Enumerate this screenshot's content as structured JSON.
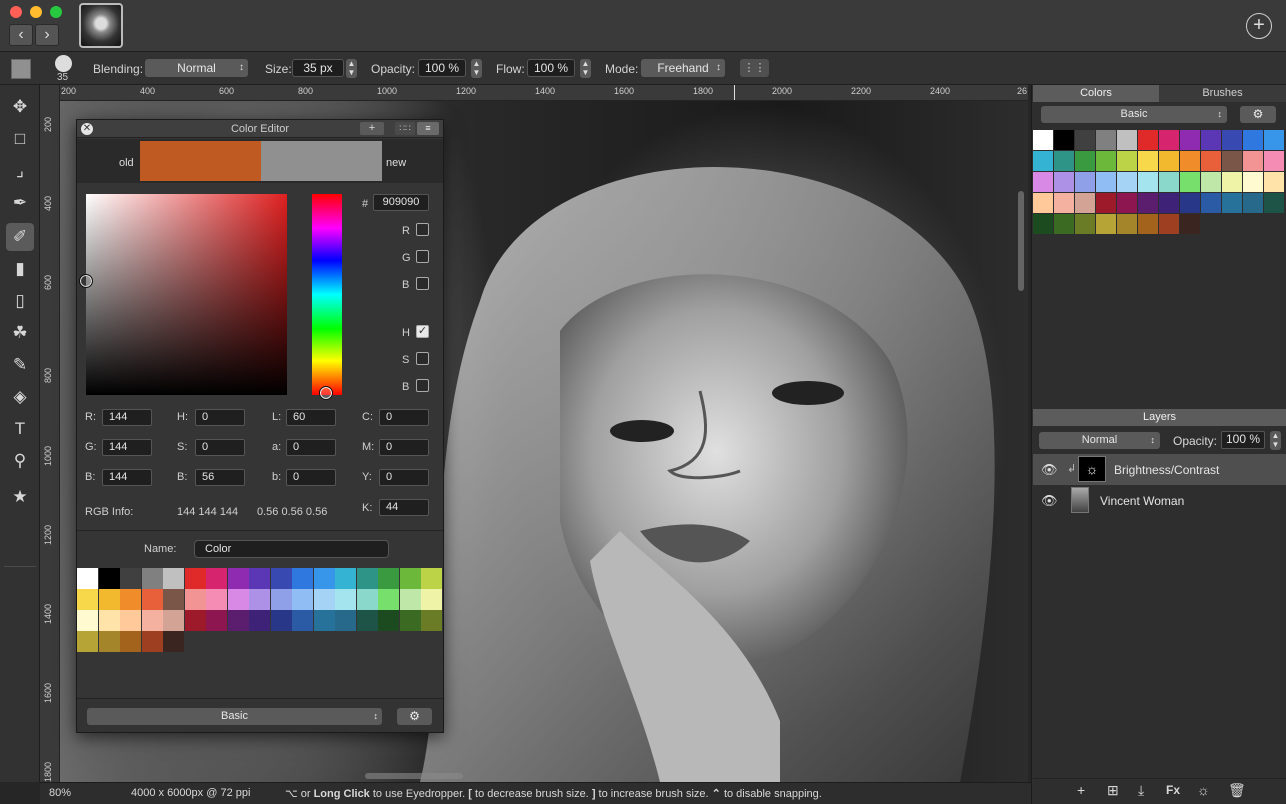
{
  "toolbar": {
    "brush_size": "35",
    "blending_label": "Blending:",
    "blending_value": "Normal",
    "size_label": "Size:",
    "size_value": "35 px",
    "opacity_label": "Opacity:",
    "opacity_value": "100 %",
    "flow_label": "Flow:",
    "flow_value": "100 %",
    "mode_label": "Mode:",
    "mode_value": "Freehand"
  },
  "rulers": {
    "top": [
      "200",
      "400",
      "600",
      "800",
      "1000",
      "1200",
      "1400",
      "1600",
      "1800",
      "2000",
      "2200",
      "2400",
      "26"
    ],
    "left": [
      "200",
      "400",
      "600",
      "800",
      "1000",
      "1200",
      "1400",
      "1600",
      "1800"
    ]
  },
  "color_editor": {
    "title": "Color Editor",
    "old_label": "old",
    "new_label": "new",
    "old_color": "#bf5a22",
    "new_color": "#909090",
    "hex_prefix": "#",
    "hex_value": "909090",
    "channels": {
      "r_check": "R",
      "g_check": "G",
      "b_check": "B",
      "h_check": "H",
      "s_check": "S",
      "bb_check": "B"
    },
    "fields": {
      "r_label": "R:",
      "r": "144",
      "g_label": "G:",
      "g": "144",
      "b_label": "B:",
      "b": "144",
      "h_label": "H:",
      "h": "0",
      "s_label": "S:",
      "s": "0",
      "bv_label": "B:",
      "bv": "56",
      "l_label": "L:",
      "l": "60",
      "a_label": "a:",
      "a": "0",
      "lab_b_label": "b:",
      "lab_b": "0",
      "c_label": "C:",
      "c": "0",
      "m_label": "M:",
      "m": "0",
      "y_label": "Y:",
      "y": "0",
      "k_label": "K:",
      "k": "44"
    },
    "rgb_info_label": "RGB Info:",
    "rgb_info_values": "144 144 144",
    "rgb_info_float": "0.56 0.56 0.56",
    "name_label": "Name:",
    "name_value": "Color",
    "palette_select": "Basic",
    "swatches": [
      [
        "#ffffff",
        "#000000",
        "#404040",
        "#808080",
        "#c0c0c0",
        "#e02a2a",
        "#d6256e",
        "#8e2bb0",
        "#5c37b5",
        "#3849b2",
        "#2f78e0",
        "#3795ea",
        "#34b3d3",
        "#2f9488",
        "#3a9a3f",
        "#6bb83b",
        "#bcd247"
      ],
      [
        "#f7d84a",
        "#f2b92e",
        "#f08d2a",
        "#e8603a",
        "#7a5648",
        "#f39494",
        "#f58cb4",
        "#d889e6",
        "#ad91e6",
        "#8f9fe8",
        "#90bdf3",
        "#a5d3f6",
        "#a3e4ee",
        "#8ad8cc",
        "#77df6c",
        "#bfe7a8",
        "#eef3a8"
      ],
      [
        "#fffad0",
        "#ffe3a8",
        "#ffc999",
        "#f5b1a0",
        "#d3a496",
        "#9c1a2a",
        "#8e1650",
        "#5b1e6e",
        "#3e2277",
        "#283788",
        "#2a5ba4",
        "#27729a",
        "#26698a",
        "#1e5448",
        "#1c4b1f",
        "#3b6a22",
        "#6b7c26"
      ],
      [
        "#b6a437",
        "#a4852a",
        "#a3631c",
        "#9e3f22",
        "#3a2520"
      ]
    ]
  },
  "right_panel": {
    "tab_colors": "Colors",
    "tab_brushes": "Brushes",
    "palette_select": "Basic",
    "swatches": [
      [
        "#ffffff",
        "#000000",
        "#404040",
        "#808080",
        "#c0c0c0",
        "#e02a2a",
        "#d6256e",
        "#8e2bb0",
        "#5c37b5",
        "#3849b2",
        "#2f78e0",
        "#3795ea"
      ],
      [
        "#34b3d3",
        "#2f9488",
        "#3a9a3f",
        "#6bb83b",
        "#bcd247",
        "#f7d84a",
        "#f2b92e",
        "#f08d2a",
        "#e8603a",
        "#7a5648",
        "#f39494",
        "#f58cb4"
      ],
      [
        "#d889e6",
        "#ad91e6",
        "#8f9fe8",
        "#90bdf3",
        "#a5d3f6",
        "#a3e4ee",
        "#8ad8cc",
        "#77df6c",
        "#bfe7a8",
        "#eef3a8",
        "#fffad0",
        "#ffe3a8"
      ],
      [
        "#ffc999",
        "#f5b1a0",
        "#d3a496",
        "#9c1a2a",
        "#8e1650",
        "#5b1e6e",
        "#3e2277",
        "#283788",
        "#2a5ba4",
        "#27729a",
        "#26698a",
        "#1e5448"
      ],
      [
        "#1c4b1f",
        "#3b6a22",
        "#6b7c26",
        "#b6a437",
        "#a4852a",
        "#a3631c",
        "#9e3f22",
        "#3a2520"
      ]
    ],
    "layers_title": "Layers",
    "layers_blend": "Normal",
    "layers_opacity_label": "Opacity:",
    "layers_opacity_value": "100 %",
    "layers": [
      {
        "name": "Brightness/Contrast",
        "selected": true
      },
      {
        "name": "Vincent Woman",
        "selected": false
      }
    ],
    "footer_fx": "Fx"
  },
  "status": {
    "zoom": "80%",
    "doc_info": "4000 x 6000px @ 72 ppi",
    "hint_1": "⌥ or",
    "hint_bold_1": "Long Click",
    "hint_2": "to use Eyedropper.",
    "hint_bold_2": "[",
    "hint_3": "to decrease brush size.",
    "hint_bold_3": "]",
    "hint_4": "to increase brush size.",
    "hint_bold_4": "⌃",
    "hint_5": "to disable snapping."
  }
}
